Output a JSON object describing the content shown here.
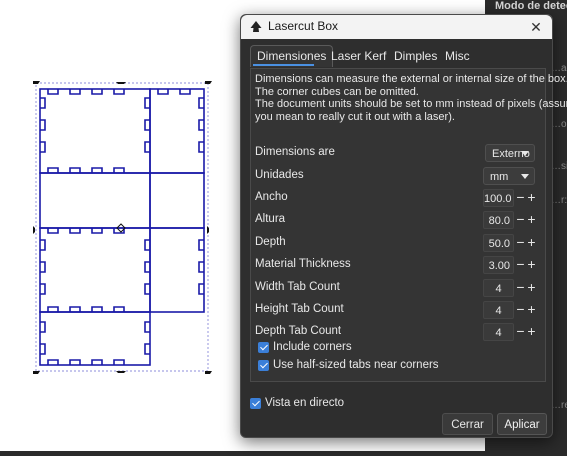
{
  "right_panel": {
    "title": "Modo de detección",
    "fragments": [
      "…agen",
      "…orde",
      "…sidi",
      "…r:",
      "…recte"
    ]
  },
  "dialog": {
    "title": "Lasercut Box",
    "close_glyph": "✕",
    "tabs": [
      "Dimensiones",
      "Laser Kerf",
      "Dimples",
      "Misc"
    ],
    "active_tab": "Dimensiones",
    "description": [
      "Dimensions can measure the external or internal size of the box.",
      "The corner cubes can be omitted.",
      "The document units should be set to mm instead of pixels (assuming",
      "you mean to really cut it out with a laser)."
    ],
    "dimensions_are": {
      "label": "Dimensions are",
      "value": "Externo"
    },
    "units": {
      "label": "Unidades",
      "value": "mm"
    },
    "fields": [
      {
        "label": "Ancho",
        "value": "100.0"
      },
      {
        "label": "Altura",
        "value": "80.0"
      },
      {
        "label": "Depth",
        "value": "50.0"
      },
      {
        "label": "Material Thickness",
        "value": "3.00"
      },
      {
        "label": "Width Tab Count",
        "value": "4"
      },
      {
        "label": "Height Tab Count",
        "value": "4"
      },
      {
        "label": "Depth Tab Count",
        "value": "4"
      }
    ],
    "spin_minus": "−",
    "spin_plus": "+",
    "checks": [
      {
        "label": "Include corners",
        "checked": true
      },
      {
        "label": "Use half-sized tabs near corners",
        "checked": true
      }
    ],
    "live_preview": {
      "label": "Vista en directo",
      "checked": true
    },
    "cancel_label": "Cerrar",
    "apply_label": "Aplicar"
  },
  "colors": {
    "accent": "#3b7fd8",
    "tab_underline": "#4a90e2",
    "box_outline": "#1a1aa8",
    "dialog_bg": "#2e2e2e",
    "titlebar_bg": "#f3f3f3"
  }
}
